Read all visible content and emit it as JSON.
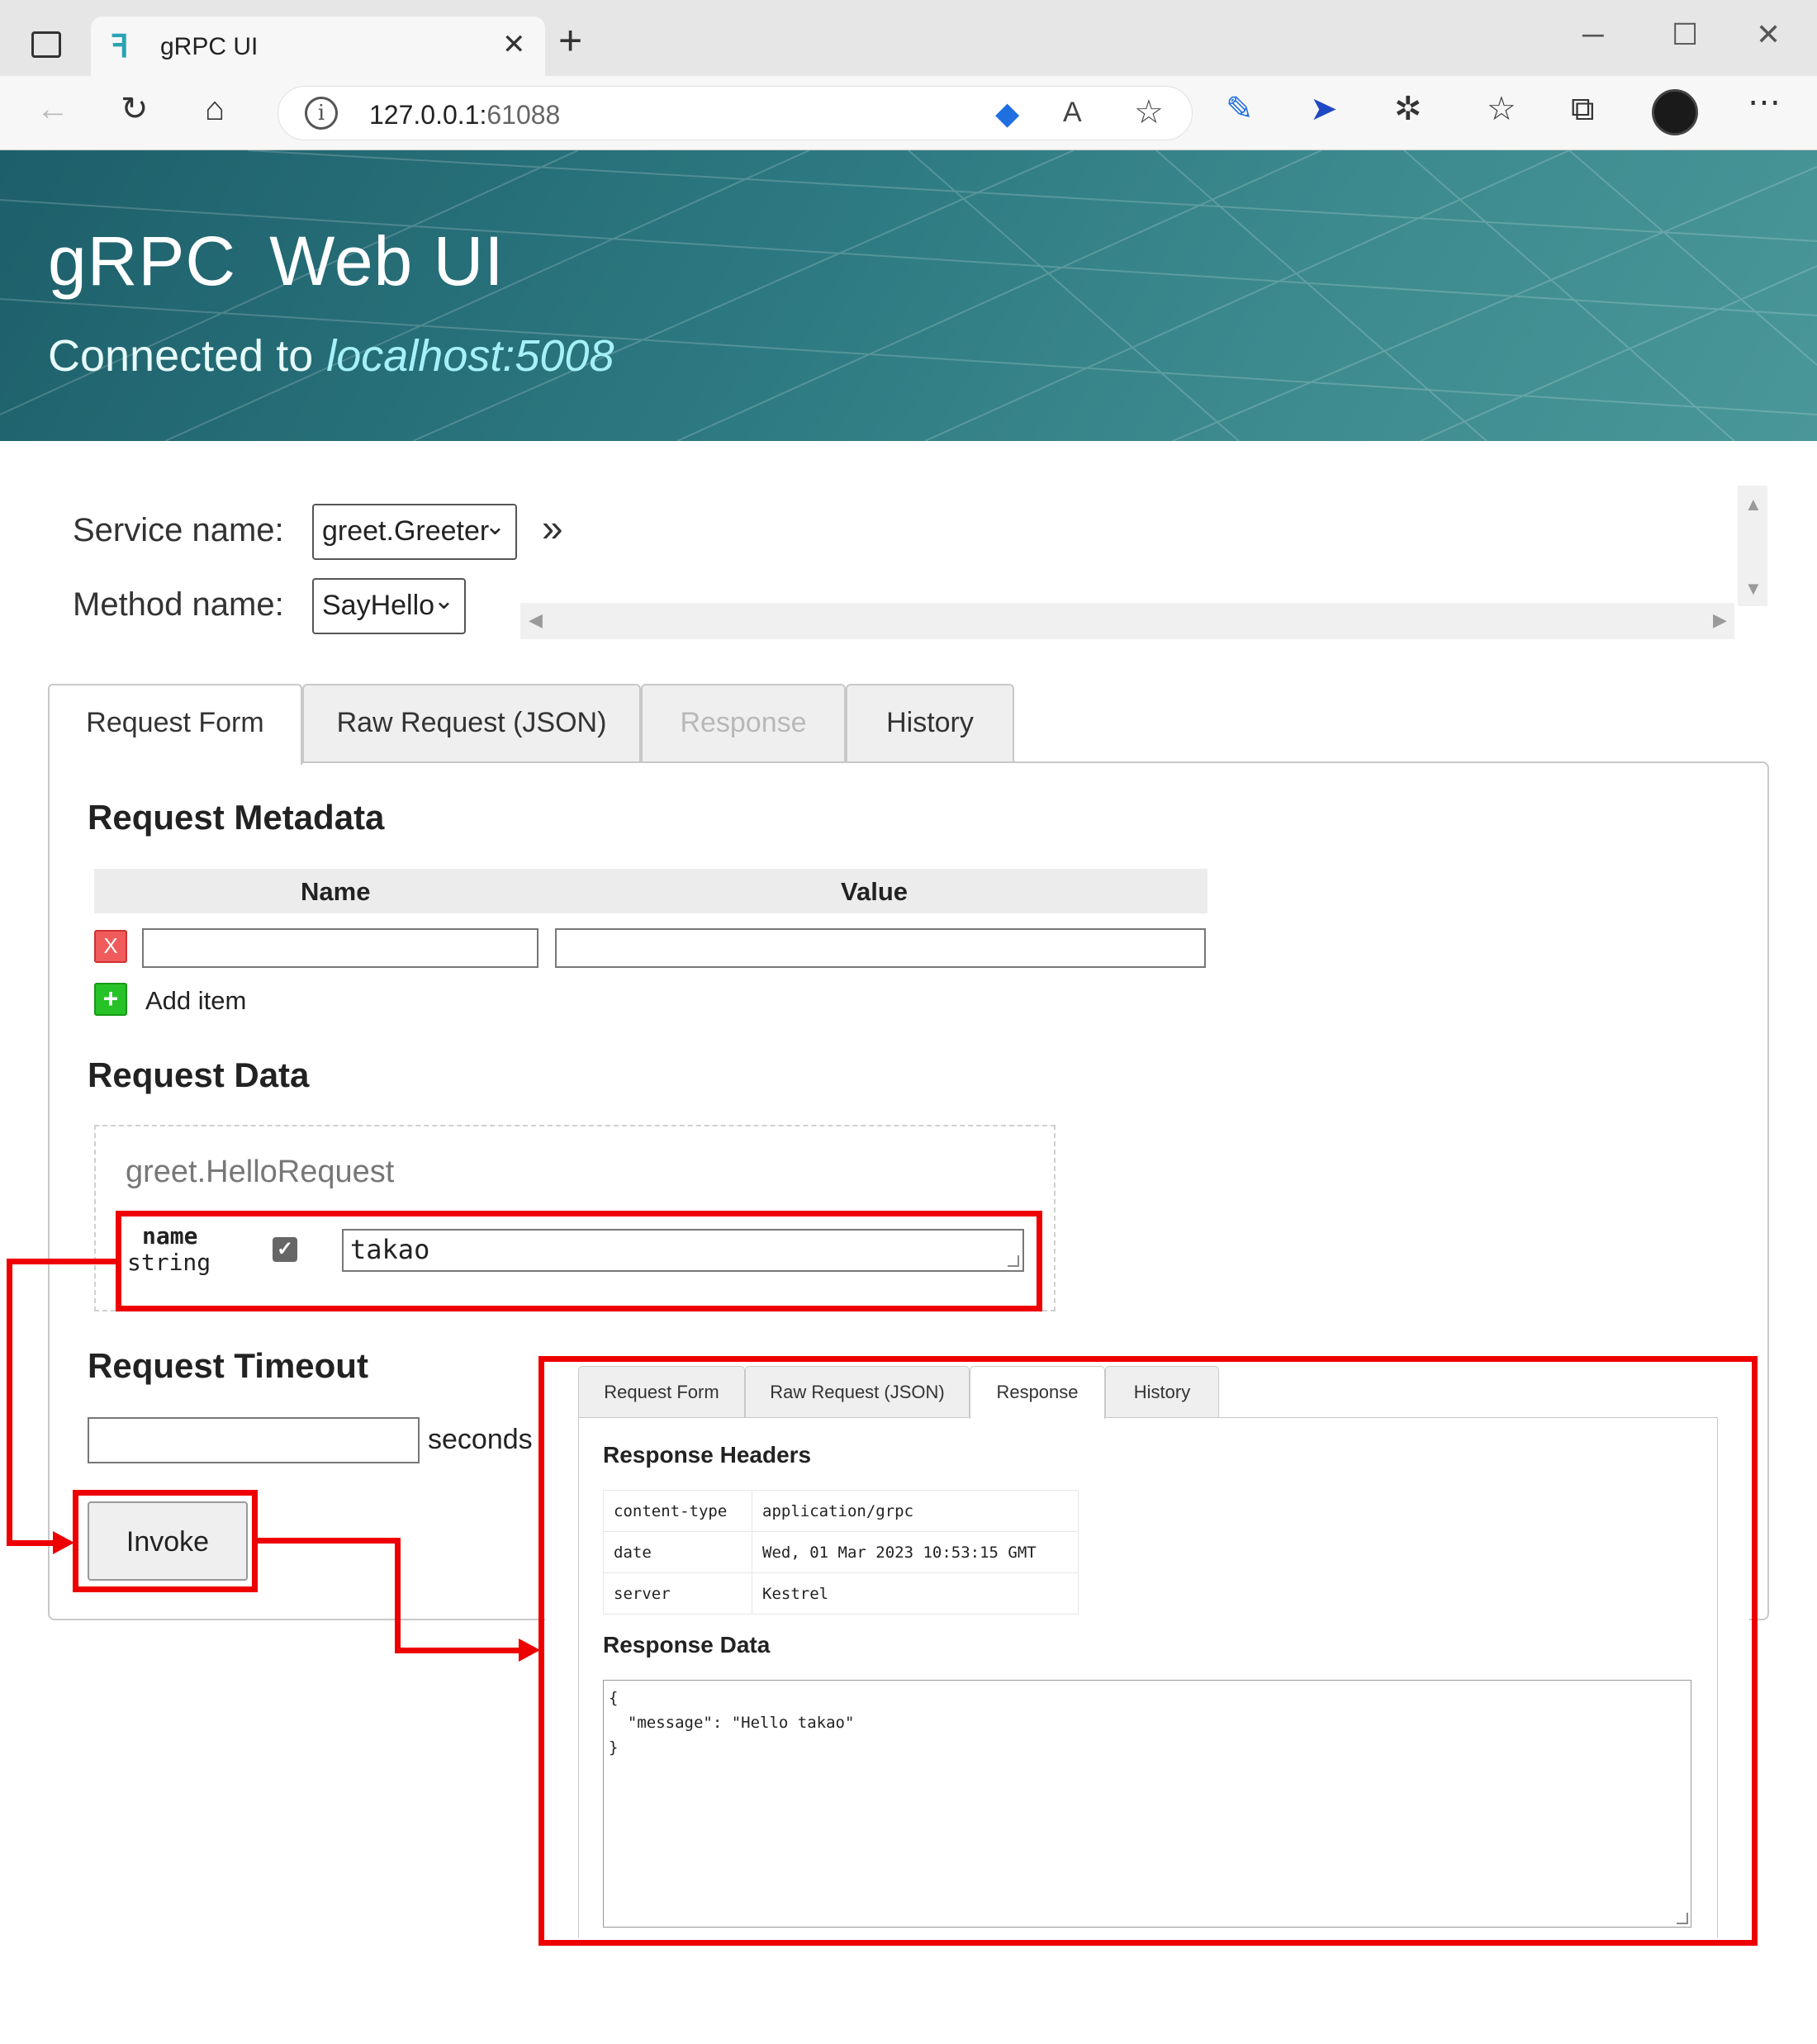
{
  "browser": {
    "tab_title": "gRPC UI",
    "address_host": "127.0.0.1:",
    "address_port": "61088"
  },
  "banner": {
    "logo": "gRPC",
    "title": "Web UI",
    "connected_label": "Connected to",
    "host": "localhost:5008"
  },
  "selectors": {
    "service_label": "Service name:",
    "service_value": "greet.Greeter",
    "method_label": "Method name:",
    "method_value": "SayHello",
    "expand_glyph": "»"
  },
  "tabs": [
    {
      "label": "Request Form",
      "state": "active"
    },
    {
      "label": "Raw Request (JSON)",
      "state": "normal"
    },
    {
      "label": "Response",
      "state": "disabled"
    },
    {
      "label": "History",
      "state": "normal"
    }
  ],
  "metadata": {
    "heading": "Request Metadata",
    "col_name": "Name",
    "col_value": "Value",
    "remove_glyph": "X",
    "add_glyph": "+",
    "add_label": "Add item"
  },
  "request_data": {
    "heading": "Request Data",
    "message_type": "greet.HelloRequest",
    "field_name": "name",
    "field_type": "string",
    "field_value": "takao",
    "checked": true
  },
  "timeout": {
    "heading": "Request Timeout",
    "unit": "seconds"
  },
  "invoke_label": "Invoke",
  "response_panel": {
    "tabs": [
      {
        "label": "Request Form",
        "state": "normal"
      },
      {
        "label": "Raw Request (JSON)",
        "state": "normal"
      },
      {
        "label": "Response",
        "state": "active"
      },
      {
        "label": "History",
        "state": "normal"
      }
    ],
    "headers_heading": "Response Headers",
    "headers": [
      {
        "key": "content-type",
        "value": "application/grpc"
      },
      {
        "key": "date",
        "value": "Wed, 01 Mar 2023 10:53:15 GMT"
      },
      {
        "key": "server",
        "value": "Kestrel"
      }
    ],
    "data_heading": "Response Data",
    "data_body": "{\n  \"message\": \"Hello takao\"\n}"
  },
  "colors": {
    "annotation": "#ee0000",
    "banner": "#2e7a82",
    "host_text": "#a6f1f7"
  }
}
